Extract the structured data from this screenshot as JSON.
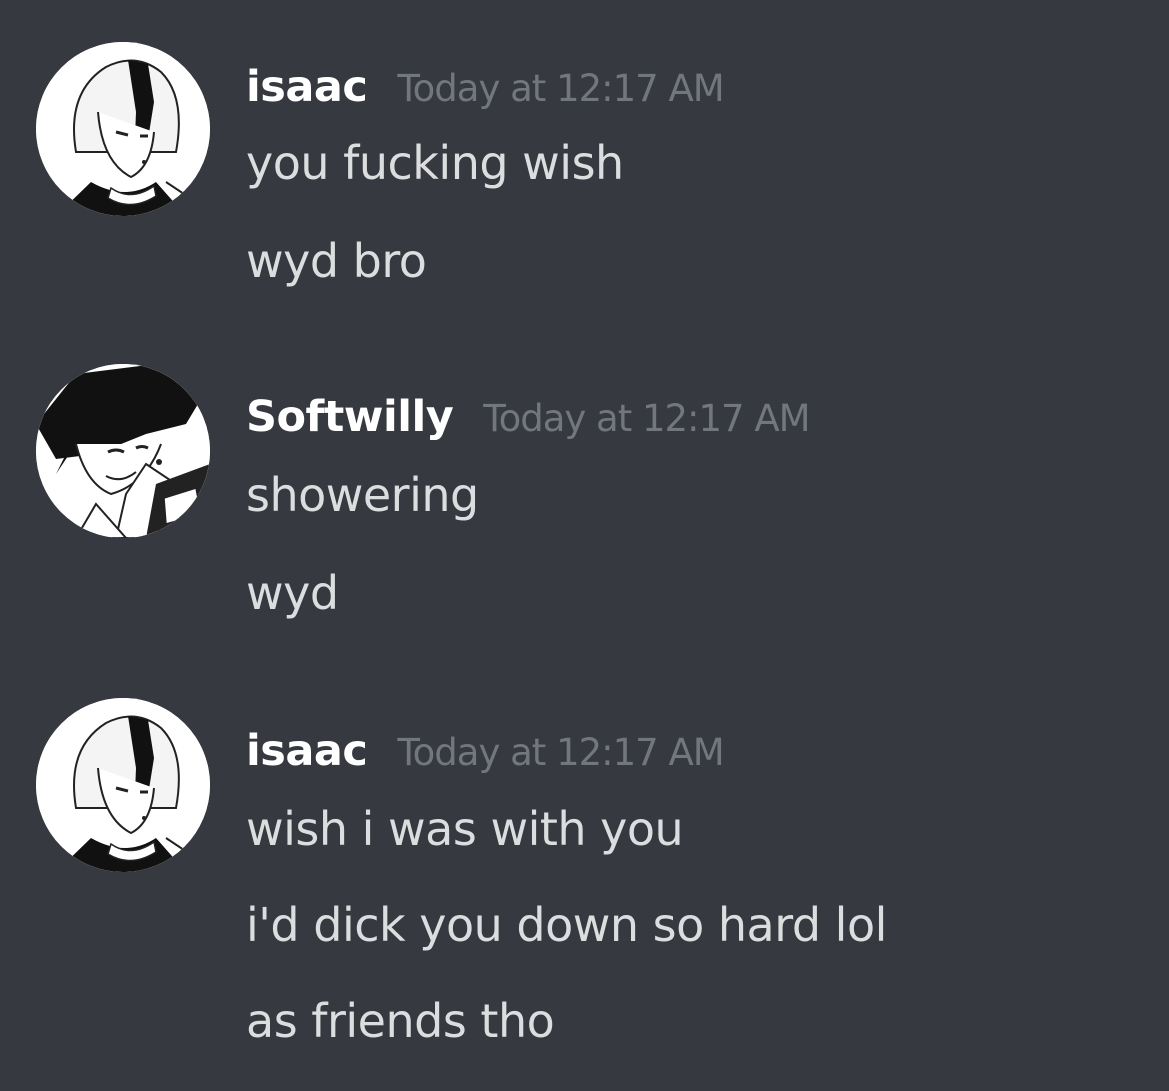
{
  "messages": [
    {
      "username": "isaac",
      "timestamp": "Today at 12:17 AM",
      "avatar": "isaac-avatar",
      "lines": [
        "you fucking wish",
        "wyd bro"
      ]
    },
    {
      "username": "Softwilly",
      "timestamp": "Today at 12:17 AM",
      "avatar": "softwilly-avatar",
      "lines": [
        "showering",
        "wyd"
      ]
    },
    {
      "username": "isaac",
      "timestamp": "Today at 12:17 AM",
      "avatar": "isaac-avatar",
      "lines": [
        "wish i was with you",
        "i'd dick you down so hard lol",
        "as friends tho"
      ]
    }
  ],
  "colors": {
    "background": "#36393f",
    "username": "#ffffff",
    "timestamp": "#72767d",
    "message_text": "#dcddde"
  }
}
